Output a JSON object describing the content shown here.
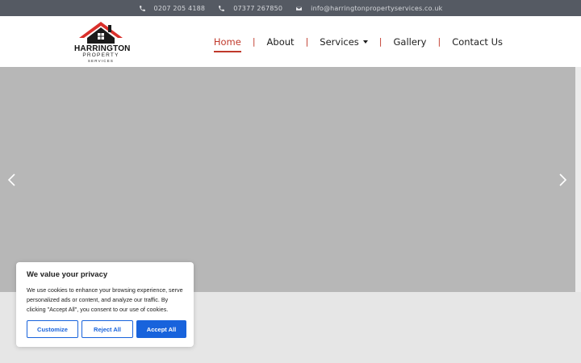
{
  "topbar": {
    "phone1": "0207 205 4188",
    "phone2": "07377 267850",
    "email": "info@harringtonpropertyservices.co.uk",
    "phone_icon": "phone-icon",
    "email_icon": "envelope-icon"
  },
  "logo": {
    "name": "HARRINGTON",
    "line2": "PROPERTY",
    "line3": "SERVICES",
    "roof_color": "#d9302b",
    "house_color": "#1a1a1a"
  },
  "nav": {
    "items": [
      {
        "label": "Home",
        "active": true
      },
      {
        "label": "About"
      },
      {
        "label": "Services",
        "has_dropdown": true
      },
      {
        "label": "Gallery"
      },
      {
        "label": "Contact Us"
      }
    ],
    "separator": "|",
    "accent": "#c0392b"
  },
  "hero": {
    "background": "#b7b7b7",
    "prev_icon": "chevron-left-icon",
    "next_icon": "chevron-right-icon"
  },
  "cookie": {
    "title": "We value your privacy",
    "text": "We use cookies to enhance your browsing experience, serve personalized ads or content, and analyze our traffic. By clicking \"Accept All\", you consent to our use of cookies.",
    "customize": "Customize",
    "reject": "Reject All",
    "accept": "Accept All",
    "button_color": "#1863dc"
  }
}
